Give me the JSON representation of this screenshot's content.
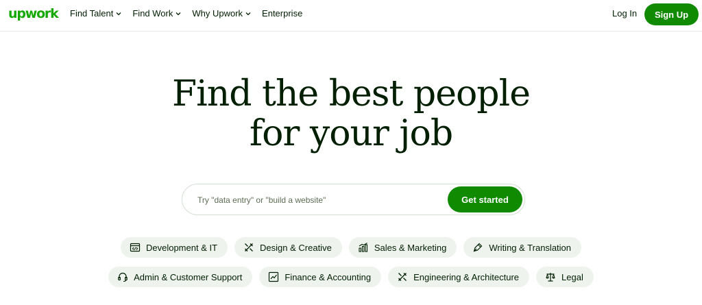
{
  "header": {
    "logo": "upwork",
    "nav": [
      {
        "label": "Find Talent",
        "has_dropdown": true
      },
      {
        "label": "Find Work",
        "has_dropdown": true
      },
      {
        "label": "Why Upwork",
        "has_dropdown": true
      },
      {
        "label": "Enterprise",
        "has_dropdown": false
      }
    ],
    "login_label": "Log In",
    "signup_label": "Sign Up"
  },
  "hero": {
    "line1": "Find the best people",
    "line2": "for your job"
  },
  "search": {
    "placeholder": "Try \"data entry\" or \"build a website\"",
    "value": "",
    "button_label": "Get started"
  },
  "categories": {
    "row1": [
      {
        "label": "Development & IT",
        "icon": "code-window-icon"
      },
      {
        "label": "Design & Creative",
        "icon": "design-tools-icon"
      },
      {
        "label": "Sales & Marketing",
        "icon": "bar-chart-icon"
      },
      {
        "label": "Writing & Translation",
        "icon": "pen-nib-icon"
      }
    ],
    "row2": [
      {
        "label": "Admin & Customer Support",
        "icon": "headset-icon"
      },
      {
        "label": "Finance & Accounting",
        "icon": "trend-chart-icon"
      },
      {
        "label": "Engineering & Architecture",
        "icon": "drafting-tools-icon"
      },
      {
        "label": "Legal",
        "icon": "scales-icon"
      }
    ]
  },
  "colors": {
    "brand_green": "#14a800",
    "button_green": "#108a00",
    "text_dark": "#001e00",
    "chip_bg": "#eef3ee"
  }
}
